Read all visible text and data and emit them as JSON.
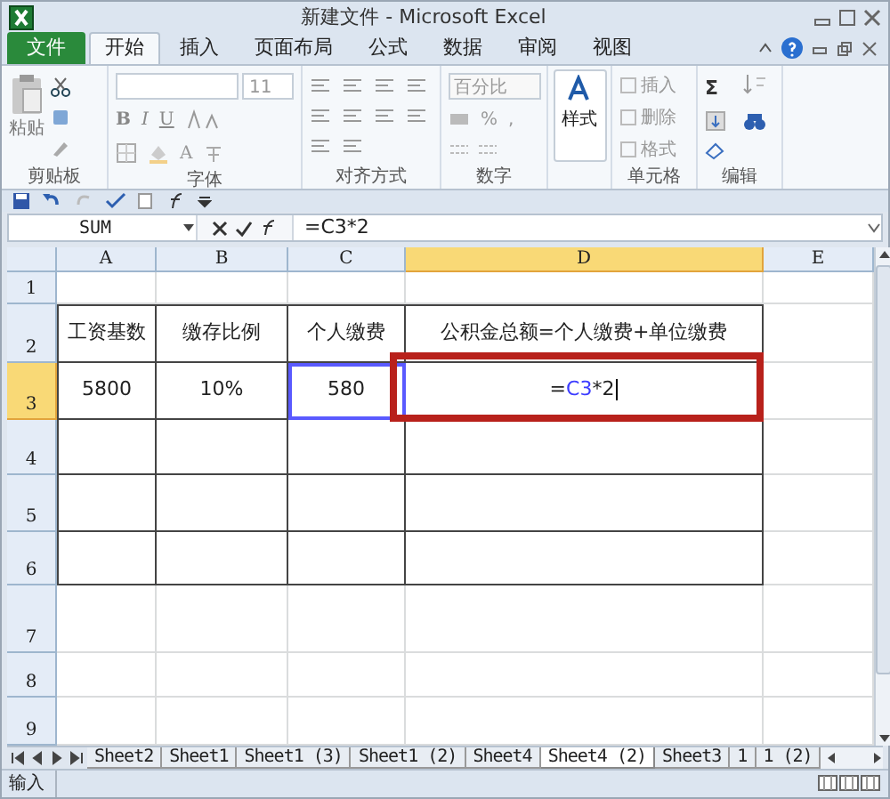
{
  "window": {
    "title": "新建文件 - Microsoft Excel"
  },
  "ribbon_tabs": [
    {
      "label": "文件",
      "kind": "file",
      "selected": false
    },
    {
      "label": "开始",
      "kind": "tab",
      "selected": true
    },
    {
      "label": "插入",
      "kind": "tab",
      "selected": false
    },
    {
      "label": "页面布局",
      "kind": "tab",
      "selected": false
    },
    {
      "label": "公式",
      "kind": "tab",
      "selected": false
    },
    {
      "label": "数据",
      "kind": "tab",
      "selected": false
    },
    {
      "label": "审阅",
      "kind": "tab",
      "selected": false
    },
    {
      "label": "视图",
      "kind": "tab",
      "selected": false
    }
  ],
  "ribbon": {
    "paste": "粘贴",
    "font_size": "11",
    "bold": "B",
    "italic": "I",
    "underline": "U",
    "font_color": "A",
    "number_format": "百分比",
    "percent": "%",
    "comma": ",",
    "styles": "样式",
    "insert": "插入",
    "delete": "删除",
    "format": "格式",
    "sum": "Σ",
    "groups": [
      "剪贴板",
      "字体",
      "对齐方式",
      "数字",
      "单元格",
      "编辑"
    ]
  },
  "formula_bar": {
    "name_box": "SUM",
    "formula": "=C3*2"
  },
  "columns": [
    {
      "label": "A",
      "selected": false
    },
    {
      "label": "B",
      "selected": false
    },
    {
      "label": "C",
      "selected": false
    },
    {
      "label": "D",
      "selected": true
    },
    {
      "label": "E",
      "selected": false
    }
  ],
  "rows": [
    {
      "label": "1",
      "selected": false,
      "cells": []
    },
    {
      "label": "2",
      "selected": false,
      "cells": [
        {
          "text": "工资基数"
        },
        {
          "text": "缴存比例"
        },
        {
          "text": "个人缴费"
        },
        {
          "text": "公积金总额=个人缴费+单位缴费"
        }
      ]
    },
    {
      "label": "3",
      "selected": true,
      "cells": [
        {
          "text": "5800"
        },
        {
          "text": "10%"
        },
        {
          "text": "580",
          "kind": "referenced"
        },
        {
          "kind": "editing",
          "parts": [
            {
              "text": "=",
              "kind": "op"
            },
            {
              "text": "C3",
              "kind": "ref"
            },
            {
              "text": "*2",
              "kind": "op"
            }
          ]
        }
      ]
    },
    {
      "label": "4",
      "selected": false,
      "cells": []
    },
    {
      "label": "5",
      "selected": false,
      "cells": []
    },
    {
      "label": "6",
      "selected": false,
      "cells": []
    },
    {
      "label": "7",
      "selected": false,
      "cells": []
    },
    {
      "label": "8",
      "selected": false,
      "cells": []
    },
    {
      "label": "9",
      "selected": false,
      "cells": []
    }
  ],
  "sheet_tabs": [
    {
      "label": "Sheet2",
      "selected": false
    },
    {
      "label": "Sheet1",
      "selected": false
    },
    {
      "label": "Sheet1 (3)",
      "selected": false
    },
    {
      "label": "Sheet1 (2)",
      "selected": false
    },
    {
      "label": "Sheet4",
      "selected": false
    },
    {
      "label": "Sheet4 (2)",
      "selected": true
    },
    {
      "label": "Sheet3",
      "selected": false
    },
    {
      "label": "1",
      "selected": false
    },
    {
      "label": "1 (2)",
      "selected": false
    }
  ],
  "status_bar": {
    "mode": "输入"
  }
}
